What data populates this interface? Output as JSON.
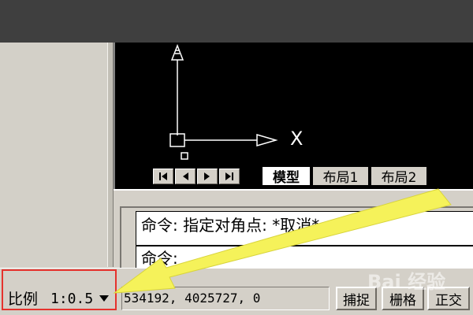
{
  "colors": {
    "viewport_bg": "#000000",
    "chrome_bg": "#d4d0c8",
    "highlight_box": "#e5322d",
    "pointer_arrow": "#f5f25a"
  },
  "viewport": {
    "ucs_icon": "ucs-axis-icon",
    "x_axis_label": "X"
  },
  "layout_tabs": {
    "nav_icons": [
      "first-tab-icon",
      "previous-tab-icon",
      "next-tab-icon",
      "last-tab-icon"
    ],
    "tabs": [
      {
        "label": "模型",
        "active": true
      },
      {
        "label": "布局1",
        "active": false
      },
      {
        "label": "布局2",
        "active": false
      }
    ]
  },
  "command": {
    "lines": [
      "命令: 指定对角点: *取消*",
      "命令:"
    ]
  },
  "status_bar": {
    "scale_label": "比例",
    "scale_value": "1:0.5",
    "coordinates": "534192, 4025727, 0",
    "buttons": [
      "捕捉",
      "栅格",
      "正交"
    ]
  },
  "watermark": "Bai 经验"
}
